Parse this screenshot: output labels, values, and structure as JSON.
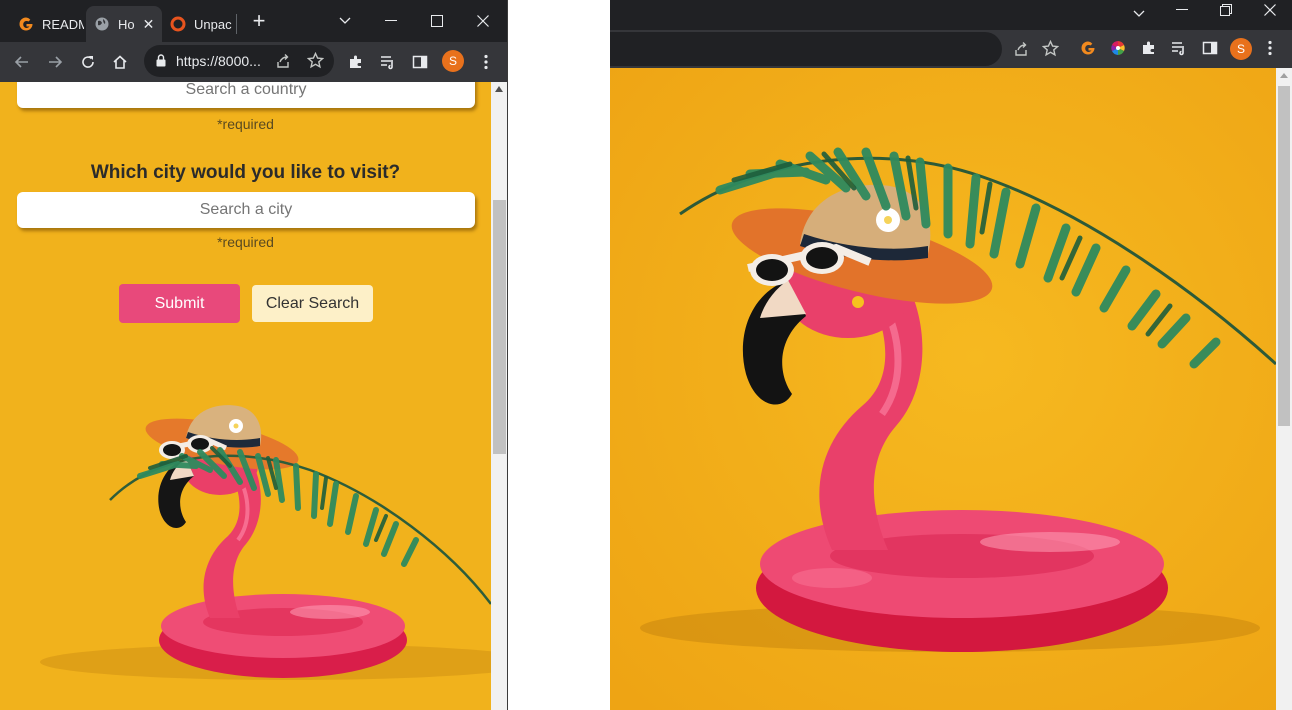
{
  "left_browser": {
    "tabs": [
      {
        "label": "READM",
        "icon": "g-logo-icon",
        "active": false
      },
      {
        "label": "Ho",
        "icon": "globe-icon",
        "active": true
      },
      {
        "label": "Unpac",
        "icon": "ring-logo-icon",
        "active": false
      }
    ],
    "new_tab_symbol": "+",
    "address": "https://8000...",
    "avatar_letter": "S"
  },
  "form": {
    "country_placeholder": "Search a country",
    "country_required": "*required",
    "city_question": "Which city would you like to visit?",
    "city_placeholder": "Search a city",
    "city_required": "*required",
    "submit_label": "Submit",
    "clear_label": "Clear Search"
  },
  "right_browser": {
    "avatar_letter": "S"
  },
  "colors": {
    "page_background": "#f1b21c",
    "submit_button": "#e8497b",
    "clear_button": "#fdf0c8",
    "browser_frame": "#202124",
    "toolbar": "#35363a",
    "avatar": "#e8711c"
  },
  "image": {
    "subject": "pink flamingo pool float with sun hat, sunglasses and palm leaf on yellow background"
  }
}
